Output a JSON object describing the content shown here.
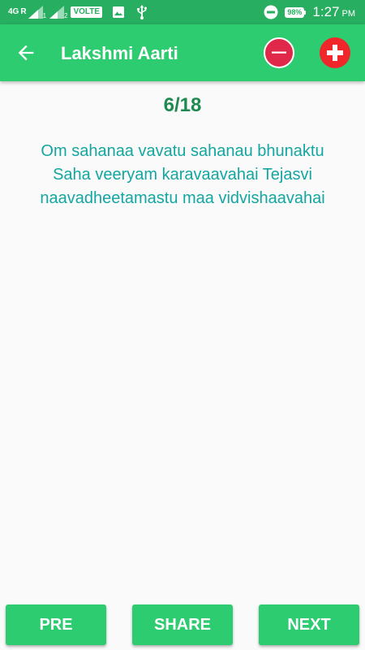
{
  "status_bar": {
    "network": "4G",
    "sim1_label": "R",
    "sim1_number": "1",
    "sim2_number": "2",
    "volte": "VOLTE",
    "battery": "98%",
    "time": "1:27",
    "ampm": "PM",
    "icons": [
      "signal-icon",
      "image-icon",
      "usb-icon",
      "dnd-icon",
      "battery-icon"
    ]
  },
  "app_bar": {
    "title": "Lakshmi Aarti",
    "back_icon": "arrow-left-icon",
    "decrease_icon": "minus-circle-icon",
    "increase_icon": "plus-circle-icon"
  },
  "content": {
    "counter": "6/18",
    "verse_lines": [
      "Om sahanaa vavatu sahanau bhunaktu",
      "Saha veeryam karavaavahai Tejasvi",
      "naavadheetamastu maa vidvishaavahai"
    ]
  },
  "buttons": {
    "pre": "PRE",
    "share": "SHARE",
    "next": "NEXT"
  },
  "colors": {
    "status_bar": "#27ae60",
    "app_bar": "#2ecc71",
    "counter_text": "#1e8a4f",
    "verse_text": "#14a6a0",
    "minus_button": "#e0294a",
    "plus_button": "#f0262b"
  }
}
